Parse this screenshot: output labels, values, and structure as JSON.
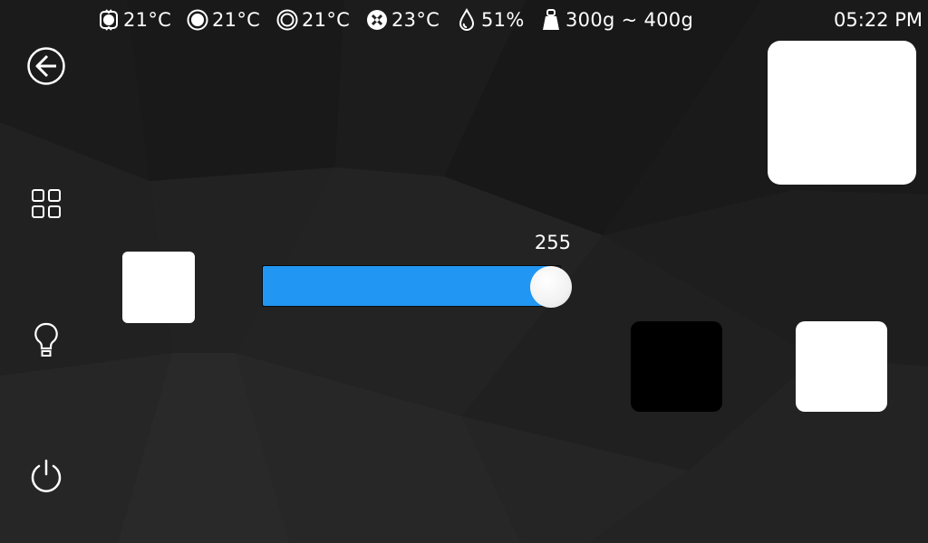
{
  "status_bar": {
    "items": [
      {
        "icon": "extruder-temp-icon",
        "text": "21°C"
      },
      {
        "icon": "bed-temp-icon",
        "text": "21°C"
      },
      {
        "icon": "chamber-temp-icon",
        "text": "21°C"
      },
      {
        "icon": "fan-temp-icon",
        "text": "23°C"
      },
      {
        "icon": "humidity-icon",
        "text": "51%"
      },
      {
        "icon": "weight-icon",
        "text": "300g ~ 400g"
      }
    ],
    "time": "05:22 PM"
  },
  "sidebar": {
    "items": [
      {
        "icon": "back-arrow-icon"
      },
      {
        "icon": "grid-menu-icon"
      },
      {
        "icon": "lightbulb-icon"
      },
      {
        "icon": "power-icon"
      }
    ]
  },
  "slider": {
    "value_label": "255",
    "value": 255,
    "max": 255
  },
  "colors": {
    "accent": "#2196f3",
    "tile_white": "#ffffff",
    "tile_black": "#000000",
    "background": "#1e1e1e"
  }
}
